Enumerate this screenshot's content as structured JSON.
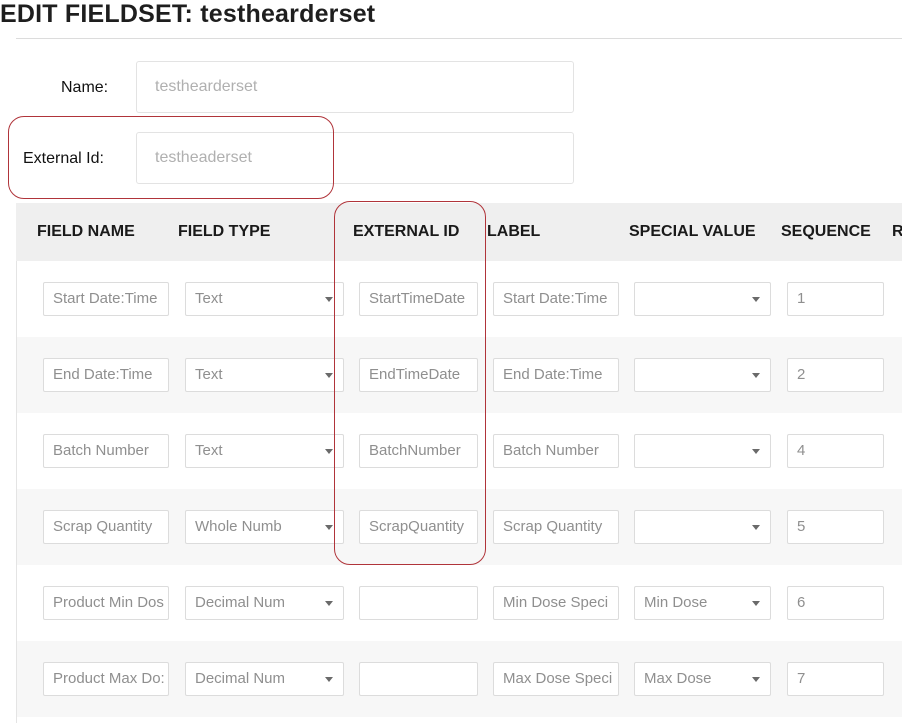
{
  "page": {
    "title": "EDIT FIELDSET: testhearderset"
  },
  "form": {
    "name_label": "Name:",
    "name_value": "testhearderset",
    "external_id_label": "External Id:",
    "external_id_value": "testheaderset"
  },
  "grid": {
    "columns": [
      "FIELD NAME",
      "FIELD TYPE",
      "EXTERNAL ID",
      "LABEL",
      "SPECIAL VALUE",
      "SEQUENCE",
      "R"
    ],
    "rows": [
      {
        "field_name": "Start Date:Time",
        "field_type": "Text",
        "external_id": "StartTimeDate",
        "label": "Start Date:Time",
        "special_value": "",
        "sequence": "1"
      },
      {
        "field_name": "End Date:Time",
        "field_type": "Text",
        "external_id": "EndTimeDate",
        "label": "End Date:Time",
        "special_value": "",
        "sequence": "2"
      },
      {
        "field_name": "Batch Number",
        "field_type": "Text",
        "external_id": "BatchNumber",
        "label": "Batch Number",
        "special_value": "",
        "sequence": "4"
      },
      {
        "field_name": "Scrap Quantity",
        "field_type": "Whole Numb",
        "external_id": "ScrapQuantity",
        "label": "Scrap Quantity",
        "special_value": "",
        "sequence": "5"
      },
      {
        "field_name": "Product Min Dos",
        "field_type": "Decimal Num",
        "external_id": "",
        "label": "Min Dose Speci",
        "special_value": "Min Dose",
        "sequence": "6"
      },
      {
        "field_name": "Product Max Do:",
        "field_type": "Decimal Num",
        "external_id": "",
        "label": "Max Dose Speci",
        "special_value": "Max Dose",
        "sequence": "7"
      }
    ]
  },
  "colors": {
    "highlight": "#b0343a",
    "header_bg": "#efefef",
    "alt_row_bg": "#f7f7f7"
  }
}
